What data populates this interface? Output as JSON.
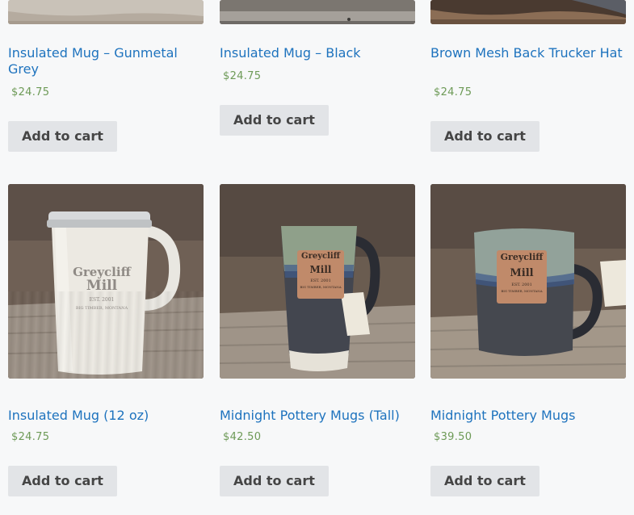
{
  "products_top": [
    {
      "title": "Insulated Mug – Gunmetal Grey",
      "price": "$24.75",
      "button": "Add to cart",
      "image": "gunmetal-mug-photo"
    },
    {
      "title": "Insulated Mug – Black",
      "price": "$24.75",
      "button": "Add to cart",
      "image": "black-mug-photo"
    },
    {
      "title": "Brown Mesh Back Trucker Hat",
      "price": "$24.75",
      "button": "Add to cart",
      "image": "trucker-hat-photo"
    }
  ],
  "products_bottom": [
    {
      "title": "Insulated Mug (12 oz)",
      "price": "$24.75",
      "button": "Add to cart",
      "image": "white-insulated-mug-photo",
      "logo_line1": "Greycliff",
      "logo_line2": "Mill",
      "logo_est": "EST. 2001",
      "logo_loc": "BIG TIMBER, MONTANA"
    },
    {
      "title": "Midnight Pottery Mugs (Tall)",
      "price": "$42.50",
      "button": "Add to cart",
      "image": "tall-pottery-mug-photo",
      "logo_line1": "Greycliff",
      "logo_line2": "Mill",
      "logo_est": "EST. 2001",
      "logo_loc": "BIG TIMBER, MONTANA"
    },
    {
      "title": "Midnight Pottery Mugs",
      "price": "$39.50",
      "button": "Add to cart",
      "image": "pottery-mug-photo",
      "logo_line1": "Greycliff",
      "logo_line2": "Mill",
      "logo_est": "EST. 2001",
      "logo_loc": "BIG TIMBER, MONTANA"
    }
  ],
  "colors": {
    "link": "#1e73be",
    "price": "#6d9a57",
    "button_bg": "#e2e4e7",
    "button_text": "#454545",
    "page_bg": "#f7f8f9"
  }
}
